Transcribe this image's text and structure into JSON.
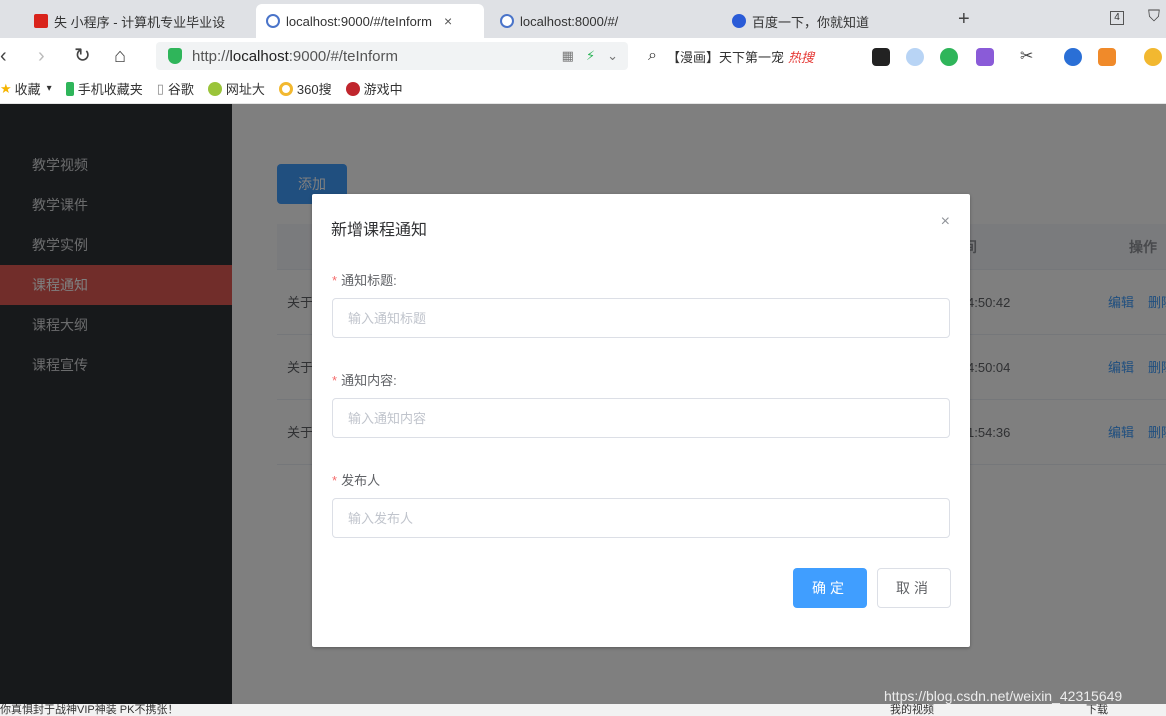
{
  "browser": {
    "tabs": [
      {
        "title": "失 小程序 - 计算机专业毕业设",
        "active": false
      },
      {
        "title": "localhost:9000/#/teInform",
        "active": true
      },
      {
        "title": "localhost:8000/#/",
        "active": false
      },
      {
        "title": "百度一下，你就知道",
        "active": false
      }
    ],
    "tab_count": "4",
    "url_prefix": "http://",
    "url_host": "localhost",
    "url_rest": ":9000/#/teInform",
    "search_text": "【漫画】天下第一宠",
    "search_hot": "热搜",
    "bookmarks": [
      "收藏",
      "手机收藏夹",
      "谷歌",
      "网址大",
      "360搜",
      "游戏中"
    ]
  },
  "sidebar": {
    "items": [
      {
        "label": "教学视频",
        "active": false
      },
      {
        "label": "教学课件",
        "active": false
      },
      {
        "label": "教学实例",
        "active": false
      },
      {
        "label": "课程通知",
        "active": true
      },
      {
        "label": "课程大纲",
        "active": false
      },
      {
        "label": "课程宣传",
        "active": false
      }
    ]
  },
  "main": {
    "add_label": "添加",
    "table": {
      "columns": [
        "间",
        "操作"
      ],
      "rows": [
        {
          "title": "关于",
          "time": "4:50:42",
          "edit": "编辑",
          "delete": "删除"
        },
        {
          "title": "关于",
          "time": "4:50:04",
          "edit": "编辑",
          "delete": "删除"
        },
        {
          "title": "关于",
          "time": "1:54:36",
          "edit": "编辑",
          "delete": "删除"
        }
      ]
    }
  },
  "dialog": {
    "title": "新增课程通知",
    "close": "×",
    "fields": [
      {
        "label": "通知标题:",
        "required": true,
        "placeholder": "输入通知标题",
        "value": ""
      },
      {
        "label": "通知内容:",
        "required": true,
        "placeholder": "输入通知内容",
        "value": ""
      },
      {
        "label": "发布人",
        "required": true,
        "placeholder": "输入发布人",
        "value": ""
      }
    ],
    "confirm_label": "确定",
    "cancel_label": "取消"
  },
  "footer": {
    "blog_url": "https://blog.csdn.net/weixin_42315649",
    "status_left": "你真惧封于战神VIP神装 PK不携张！",
    "status_right": "我的视频",
    "status_download": "下载"
  },
  "colors": {
    "primary": "#409eff",
    "sidebar_bg": "#2f3237",
    "sidebar_active": "#e25a55",
    "required": "#f56c6c"
  }
}
